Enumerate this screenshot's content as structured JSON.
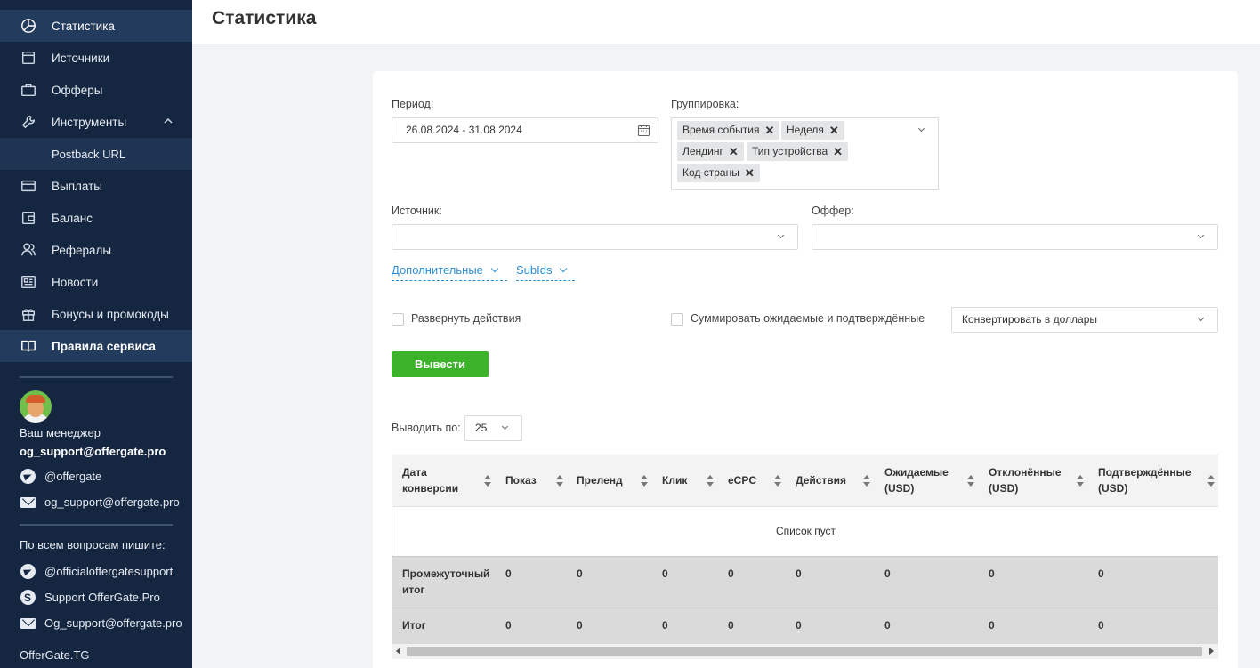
{
  "sidebar": {
    "items": [
      {
        "label": "Статистика",
        "icon": "pie-chart-icon"
      },
      {
        "label": "Источники",
        "icon": "window-icon"
      },
      {
        "label": "Офферы",
        "icon": "briefcase-icon"
      },
      {
        "label": "Инструменты",
        "icon": "wrench-icon"
      },
      {
        "label": "Postback URL"
      },
      {
        "label": "Выплаты",
        "icon": "card-icon"
      },
      {
        "label": "Баланс",
        "icon": "wallet-icon"
      },
      {
        "label": "Рефералы",
        "icon": "users-icon"
      },
      {
        "label": "Новости",
        "icon": "newspaper-icon"
      },
      {
        "label": "Бонусы и промокоды",
        "icon": "gift-icon"
      },
      {
        "label": "Правила сервиса",
        "icon": "book-icon"
      }
    ],
    "manager": {
      "label": "Ваш менеджер",
      "email": "og_support@offergate.pro",
      "telegram": "@offergate",
      "mail": "og_support@offergate.pro"
    },
    "support": {
      "heading": "По всем вопросам пишите:",
      "telegram": "@officialoffergatesupport",
      "skype": "Support OfferGate.Pro",
      "mail": "Og_support@offergate.pro"
    },
    "footer": "OfferGate.TG"
  },
  "header": {
    "title": "Статистика"
  },
  "filters": {
    "period_label": "Период:",
    "period_value": "26.08.2024 - 31.08.2024",
    "grouping_label": "Группировка:",
    "grouping_tags": [
      "Время события",
      "Неделя",
      "Лендинг",
      "Тип устройства",
      "Код страны"
    ],
    "source_label": "Источник:",
    "offer_label": "Оффер:",
    "additional_label": "Дополнительные",
    "subids_label": "SubIds",
    "expand_actions_label": "Развернуть действия",
    "sum_label": "Суммировать ожидаемые и подтверждённые",
    "convert_value": "Конвертировать в доллары",
    "submit_label": "Вывести",
    "per_page_label": "Выводить по:",
    "per_page_value": "25"
  },
  "table": {
    "columns": [
      "Дата конверсии",
      "Показ",
      "Преленд",
      "Клик",
      "eCPC",
      "Действия",
      "Ожидаемые (USD)",
      "Отклонённые (USD)",
      "Подтверждённые (USD)"
    ],
    "empty_text": "Список пуст",
    "subtotal_label": "Промежуточный итог",
    "subtotal_values": [
      "0",
      "0",
      "0",
      "0",
      "0",
      "0",
      "0",
      "0"
    ],
    "total_label": "Итог",
    "total_values": [
      "0",
      "0",
      "0",
      "0",
      "0",
      "0",
      "0",
      "0"
    ]
  }
}
